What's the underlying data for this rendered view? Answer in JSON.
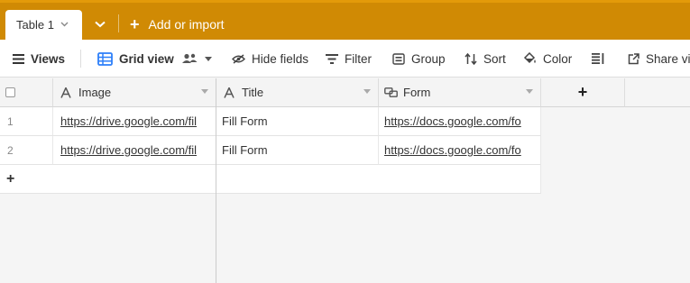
{
  "tabs": {
    "active_label": "Table 1",
    "add_import_label": "Add or import"
  },
  "toolbar": {
    "views_label": "Views",
    "grid_view_label": "Grid view",
    "hide_fields_label": "Hide fields",
    "filter_label": "Filter",
    "group_label": "Group",
    "sort_label": "Sort",
    "color_label": "Color",
    "share_label": "Share vie"
  },
  "columns": [
    {
      "label": "Image",
      "icon": "text-field-icon"
    },
    {
      "label": "Title",
      "icon": "text-field-icon"
    },
    {
      "label": "Form",
      "icon": "link-field-icon"
    }
  ],
  "rows": [
    {
      "num": "1",
      "image": "https://drive.google.com/fil",
      "title": "Fill Form",
      "form": "https://docs.google.com/fo"
    },
    {
      "num": "2",
      "image": "https://drive.google.com/fil",
      "title": "Fill Form",
      "form": "https://docs.google.com/fo"
    }
  ],
  "add_row_symbol": "+",
  "add_column_symbol": "+",
  "colors": {
    "accent": "#d08a04",
    "accent_top": "#e39a0a",
    "grid_view_icon": "#2d7ff9"
  }
}
